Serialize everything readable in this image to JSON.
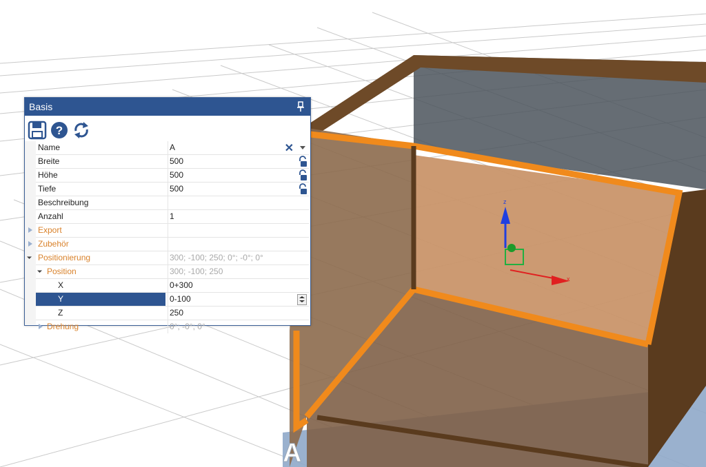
{
  "panel": {
    "title": "Basis",
    "pin_icon": "pin-icon"
  },
  "toolbar": {
    "icons": [
      "save-icon",
      "help-icon",
      "refresh-icon"
    ]
  },
  "grid": {
    "rows": {
      "name": {
        "label": "Name",
        "value": "A"
      },
      "breite": {
        "label": "Breite",
        "value": "500"
      },
      "hoehe": {
        "label": "Höhe",
        "value": "500"
      },
      "tiefe": {
        "label": "Tiefe",
        "value": "500"
      },
      "beschreibung": {
        "label": "Beschreibung",
        "value": ""
      },
      "anzahl": {
        "label": "Anzahl",
        "value": "1"
      },
      "export": {
        "label": "Export",
        "value": ""
      },
      "zubehoer": {
        "label": "Zubehör",
        "value": ""
      },
      "positionierung": {
        "label": "Positionierung",
        "value": "300; -100; 250; 0°; -0°; 0°"
      },
      "position": {
        "label": "Position",
        "value": "300; -100; 250"
      },
      "x": {
        "label": "X",
        "value": "0+300"
      },
      "y": {
        "label": "Y",
        "value": "0-100"
      },
      "z": {
        "label": "Z",
        "value": "250"
      },
      "drehung": {
        "label": "Drehung",
        "value": "0°; -0°; 0°"
      }
    }
  },
  "scene": {
    "object_label": "A",
    "gizmo": {
      "x_label": "x",
      "z_label": "z"
    },
    "colors": {
      "accent": "#2e5591",
      "category": "#d9822b",
      "selection_frame": "#f08a1c",
      "box_frame": "#5a3b1e"
    }
  }
}
